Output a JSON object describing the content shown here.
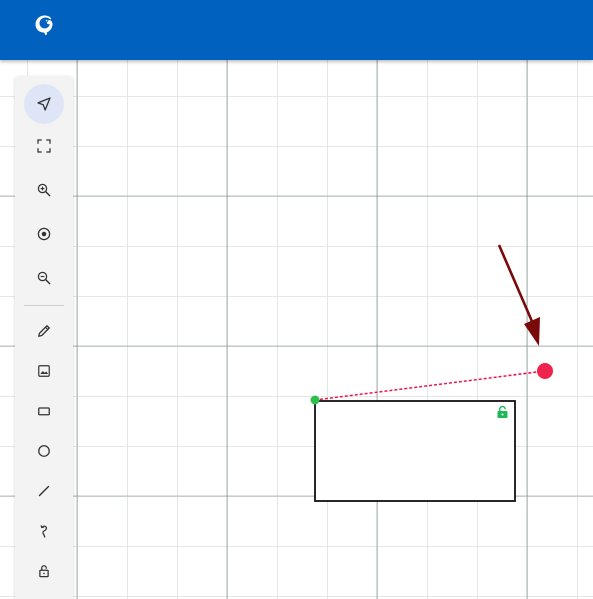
{
  "app": {
    "logo_icon": "chameleon-logo-icon",
    "topbar_color": "#0061bf"
  },
  "toolbar": {
    "tools": [
      {
        "name": "select-tool",
        "icon": "navigation-arrow-icon",
        "active": true
      },
      {
        "name": "fit-to-screen-tool",
        "icon": "expand-corners-icon",
        "active": false
      },
      {
        "name": "zoom-in-tool",
        "icon": "zoom-in-icon",
        "active": false
      },
      {
        "name": "center-view-tool",
        "icon": "target-icon",
        "active": false
      },
      {
        "name": "zoom-out-tool",
        "icon": "zoom-out-icon",
        "active": false
      },
      {
        "name": "draw-tool",
        "icon": "pencil-icon",
        "active": false
      },
      {
        "name": "image-tool",
        "icon": "image-icon",
        "active": false
      },
      {
        "name": "rectangle-tool",
        "icon": "rectangle-icon",
        "active": false
      },
      {
        "name": "circle-tool",
        "icon": "circle-icon",
        "active": false
      },
      {
        "name": "line-tool",
        "icon": "line-icon",
        "active": false
      },
      {
        "name": "connector-tool",
        "icon": "curved-arrow-icon",
        "active": false
      },
      {
        "name": "lock-tool",
        "icon": "unlock-icon",
        "active": false
      }
    ]
  },
  "canvas": {
    "shapes": [
      {
        "type": "rectangle",
        "locked": false,
        "lock_icon": "unlock-icon",
        "lock_color": "#1db954"
      }
    ],
    "connector": {
      "style": "dashed",
      "color": "#e8194f"
    },
    "pointer_arrow": {
      "color": "#7a0a0a"
    }
  }
}
